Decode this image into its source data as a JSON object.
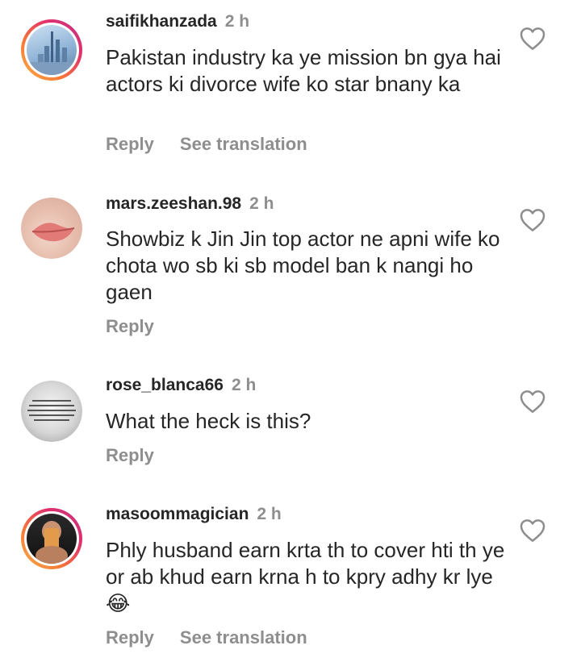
{
  "comments": [
    {
      "username": "saifikhanzada",
      "time": "2 h",
      "text": "Pakistan industry ka ye mission bn gya hai actors ki divorce wife ko star bnany ka",
      "actions": [
        "Reply",
        "See translation"
      ],
      "avatar_ring": true
    },
    {
      "username": "mars.zeeshan.98",
      "time": "2 h",
      "text": "Showbiz k Jin Jin top actor ne apni wife ko chota wo sb ki sb model ban k nangi ho gaen",
      "actions": [
        "Reply"
      ],
      "avatar_ring": false
    },
    {
      "username": "rose_blanca66",
      "time": "2 h",
      "text": "What the heck is this?",
      "actions": [
        "Reply"
      ],
      "avatar_ring": false
    },
    {
      "username": "masoommagician",
      "time": "2 h",
      "text": "Phly husband earn krta th to cover hti th ye or ab khud earn krna h to kpry adhy kr lye😂",
      "actions": [
        "Reply",
        "See translation"
      ],
      "avatar_ring": true
    }
  ],
  "icons": {
    "like": "heart-outline-icon"
  },
  "colors": {
    "primary_text": "#262626",
    "secondary_text": "#8e8e8e",
    "story_ring": [
      "#fcaf45",
      "#e1306c",
      "#c13584"
    ]
  }
}
